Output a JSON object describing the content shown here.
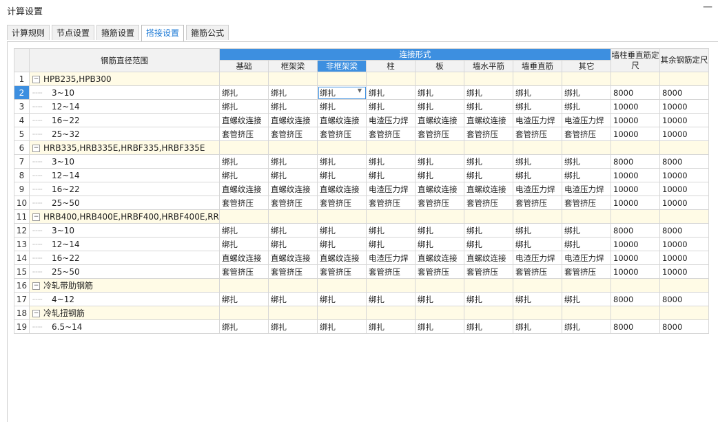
{
  "window": {
    "title": "计算设置",
    "minimize": "—"
  },
  "tabs": [
    {
      "label": "计算规则",
      "active": false
    },
    {
      "label": "节点设置",
      "active": false
    },
    {
      "label": "箍筋设置",
      "active": false
    },
    {
      "label": "搭接设置",
      "active": true
    },
    {
      "label": "箍筋公式",
      "active": false
    }
  ],
  "grid": {
    "header": {
      "range": "钢筋直径范围",
      "group": "连接形式",
      "cols": [
        "基础",
        "框架梁",
        "非框架梁",
        "柱",
        "板",
        "墙水平筋",
        "墙垂直筋",
        "其它"
      ],
      "wall_col": "墙柱垂直筋定尺",
      "other_col": "其余钢筋定尺"
    },
    "rows": [
      {
        "n": "1",
        "type": "group",
        "label": "HPB235,HPB300"
      },
      {
        "n": "2",
        "type": "data",
        "label": "3~10",
        "cells": [
          "绑扎",
          "绑扎",
          "绑扎",
          "绑扎",
          "绑扎",
          "绑扎",
          "绑扎",
          "绑扎",
          "8000",
          "8000"
        ],
        "active": true
      },
      {
        "n": "3",
        "type": "data",
        "label": "12~14",
        "cells": [
          "绑扎",
          "绑扎",
          "绑扎",
          "绑扎",
          "绑扎",
          "绑扎",
          "绑扎",
          "绑扎",
          "10000",
          "10000"
        ]
      },
      {
        "n": "4",
        "type": "data",
        "label": "16~22",
        "cells": [
          "直螺纹连接",
          "直螺纹连接",
          "直螺纹连接",
          "电渣压力焊",
          "直螺纹连接",
          "直螺纹连接",
          "电渣压力焊",
          "电渣压力焊",
          "10000",
          "10000"
        ]
      },
      {
        "n": "5",
        "type": "data",
        "label": "25~32",
        "cells": [
          "套管挤压",
          "套管挤压",
          "套管挤压",
          "套管挤压",
          "套管挤压",
          "套管挤压",
          "套管挤压",
          "套管挤压",
          "10000",
          "10000"
        ]
      },
      {
        "n": "6",
        "type": "group",
        "label": "HRB335,HRB335E,HRBF335,HRBF335E"
      },
      {
        "n": "7",
        "type": "data",
        "label": "3~10",
        "cells": [
          "绑扎",
          "绑扎",
          "绑扎",
          "绑扎",
          "绑扎",
          "绑扎",
          "绑扎",
          "绑扎",
          "8000",
          "8000"
        ]
      },
      {
        "n": "8",
        "type": "data",
        "label": "12~14",
        "cells": [
          "绑扎",
          "绑扎",
          "绑扎",
          "绑扎",
          "绑扎",
          "绑扎",
          "绑扎",
          "绑扎",
          "10000",
          "10000"
        ]
      },
      {
        "n": "9",
        "type": "data",
        "label": "16~22",
        "cells": [
          "直螺纹连接",
          "直螺纹连接",
          "直螺纹连接",
          "电渣压力焊",
          "直螺纹连接",
          "直螺纹连接",
          "电渣压力焊",
          "电渣压力焊",
          "10000",
          "10000"
        ]
      },
      {
        "n": "10",
        "type": "data",
        "label": "25~50",
        "cells": [
          "套管挤压",
          "套管挤压",
          "套管挤压",
          "套管挤压",
          "套管挤压",
          "套管挤压",
          "套管挤压",
          "套管挤压",
          "10000",
          "10000"
        ]
      },
      {
        "n": "11",
        "type": "group",
        "label": "HRB400,HRB400E,HRBF400,HRBF400E,RR..."
      },
      {
        "n": "12",
        "type": "data",
        "label": "3~10",
        "cells": [
          "绑扎",
          "绑扎",
          "绑扎",
          "绑扎",
          "绑扎",
          "绑扎",
          "绑扎",
          "绑扎",
          "8000",
          "8000"
        ]
      },
      {
        "n": "13",
        "type": "data",
        "label": "12~14",
        "cells": [
          "绑扎",
          "绑扎",
          "绑扎",
          "绑扎",
          "绑扎",
          "绑扎",
          "绑扎",
          "绑扎",
          "10000",
          "10000"
        ]
      },
      {
        "n": "14",
        "type": "data",
        "label": "16~22",
        "cells": [
          "直螺纹连接",
          "直螺纹连接",
          "直螺纹连接",
          "电渣压力焊",
          "直螺纹连接",
          "直螺纹连接",
          "电渣压力焊",
          "电渣压力焊",
          "10000",
          "10000"
        ]
      },
      {
        "n": "15",
        "type": "data",
        "label": "25~50",
        "cells": [
          "套管挤压",
          "套管挤压",
          "套管挤压",
          "套管挤压",
          "套管挤压",
          "套管挤压",
          "套管挤压",
          "套管挤压",
          "10000",
          "10000"
        ]
      },
      {
        "n": "16",
        "type": "group",
        "label": "冷轧带肋钢筋"
      },
      {
        "n": "17",
        "type": "data",
        "label": "4~12",
        "cells": [
          "绑扎",
          "绑扎",
          "绑扎",
          "绑扎",
          "绑扎",
          "绑扎",
          "绑扎",
          "绑扎",
          "8000",
          "8000"
        ]
      },
      {
        "n": "18",
        "type": "group",
        "label": "冷轧扭钢筋"
      },
      {
        "n": "19",
        "type": "data",
        "label": "6.5~14",
        "cells": [
          "绑扎",
          "绑扎",
          "绑扎",
          "绑扎",
          "绑扎",
          "绑扎",
          "绑扎",
          "绑扎",
          "8000",
          "8000"
        ]
      }
    ]
  },
  "icons": {
    "collapse": "minus-box-icon",
    "dropdown": "caret-down-icon"
  }
}
